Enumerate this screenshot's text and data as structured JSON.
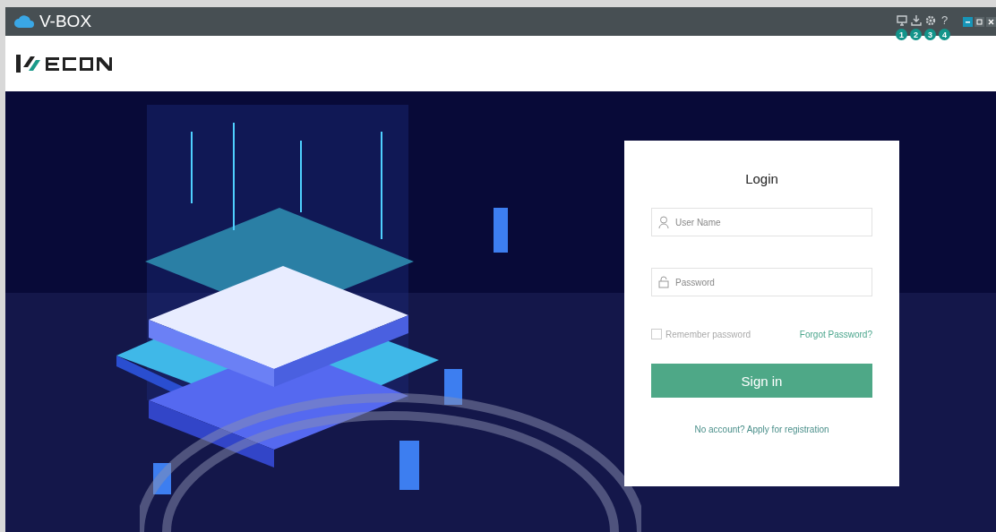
{
  "window": {
    "title": "V-BOX"
  },
  "toolbar": [
    {
      "kind": "monitor",
      "badge": "1"
    },
    {
      "kind": "download",
      "badge": "2"
    },
    {
      "kind": "gear",
      "badge": "3"
    },
    {
      "kind": "help",
      "glyph": "?",
      "badge": "4"
    }
  ],
  "login": {
    "title": "Login",
    "username": {
      "placeholder": "User Name"
    },
    "password": {
      "placeholder": "Password"
    },
    "remember": {
      "label": "Remember password",
      "checked": false
    },
    "forgot_link": "Forgot Password?",
    "submit": "Sign in",
    "register_link": "No account? Apply for registration"
  }
}
